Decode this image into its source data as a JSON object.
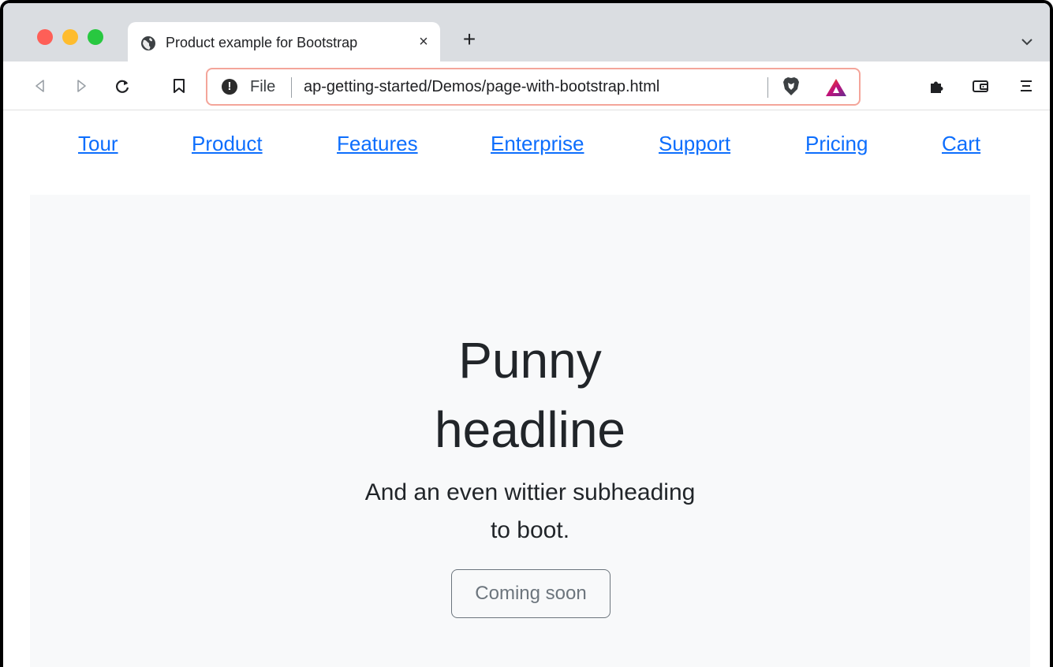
{
  "browser": {
    "tab": {
      "title": "Product example for Bootstrap",
      "close_label": "×",
      "favicon": "globe-icon"
    },
    "new_tab_label": "+",
    "toolbar": {
      "back_icon": "back-icon",
      "forward_icon": "forward-icon",
      "reload_icon": "reload-icon",
      "bookmark_icon": "bookmark-icon",
      "extensions_icon": "puzzle-icon",
      "wallet_icon": "wallet-icon",
      "menu_icon": "menu-icon"
    },
    "omnibox": {
      "info_icon": "info-icon",
      "scheme_label": "File",
      "url": "ap-getting-started/Demos/page-with-bootstrap.html",
      "shield_icon": "brave-shield-icon",
      "rewards_icon": "brave-rewards-icon"
    }
  },
  "page": {
    "nav": {
      "links": [
        "Tour",
        "Product",
        "Features",
        "Enterprise",
        "Support",
        "Pricing",
        "Cart"
      ]
    },
    "hero": {
      "headline_line1": "Punny",
      "headline_line2": "headline",
      "subheading_line1": "And an even wittier subheading",
      "subheading_line2": "to boot.",
      "button_label": "Coming soon"
    }
  },
  "colors": {
    "link": "#0d6efd",
    "hero_bg": "#f8f9fa",
    "button_border": "#6c757d",
    "text": "#212529"
  }
}
